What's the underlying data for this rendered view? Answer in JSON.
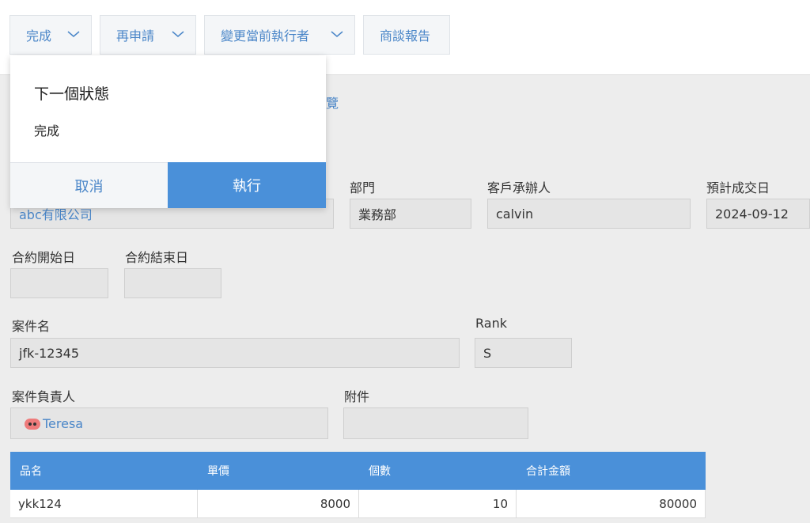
{
  "toolbar": {
    "buttons": [
      {
        "label": "完成",
        "icon": "chevron-down-icon"
      },
      {
        "label": "再申請",
        "icon": "chevron-down-icon"
      },
      {
        "label": "變更當前執行者",
        "icon": "chevron-down-icon"
      },
      {
        "label": "商談報告"
      }
    ]
  },
  "hint_text": "覽",
  "form": {
    "customer_value": "abc有限公司",
    "department_label": "部門",
    "department_value": "業務部",
    "customer_contact_label": "客戶承辦人",
    "customer_contact_value": "calvin",
    "expected_close_label": "預計成交日",
    "expected_close_value": "2024-09-12",
    "contract_start_label": "合約開始日",
    "contract_start_value": "",
    "contract_end_label": "合約結束日",
    "contract_end_value": "",
    "case_name_label": "案件名",
    "case_name_value": "jfk-12345",
    "rank_label": "Rank",
    "rank_value": "S",
    "case_owner_label": "案件負責人",
    "case_owner_value": "Teresa",
    "attachment_label": "附件",
    "attachment_value": ""
  },
  "table": {
    "headers": [
      "品名",
      "單價",
      "個數",
      "合計金額"
    ],
    "rows": [
      [
        "ykk124",
        "8000",
        "10",
        "80000"
      ]
    ]
  },
  "popup": {
    "title": "下一個狀態",
    "status": "完成",
    "cancel_label": "取消",
    "execute_label": "執行"
  },
  "colors": {
    "accent": "#4a90d9",
    "link": "#4a86c8",
    "field_bg": "#e5e5e5"
  }
}
